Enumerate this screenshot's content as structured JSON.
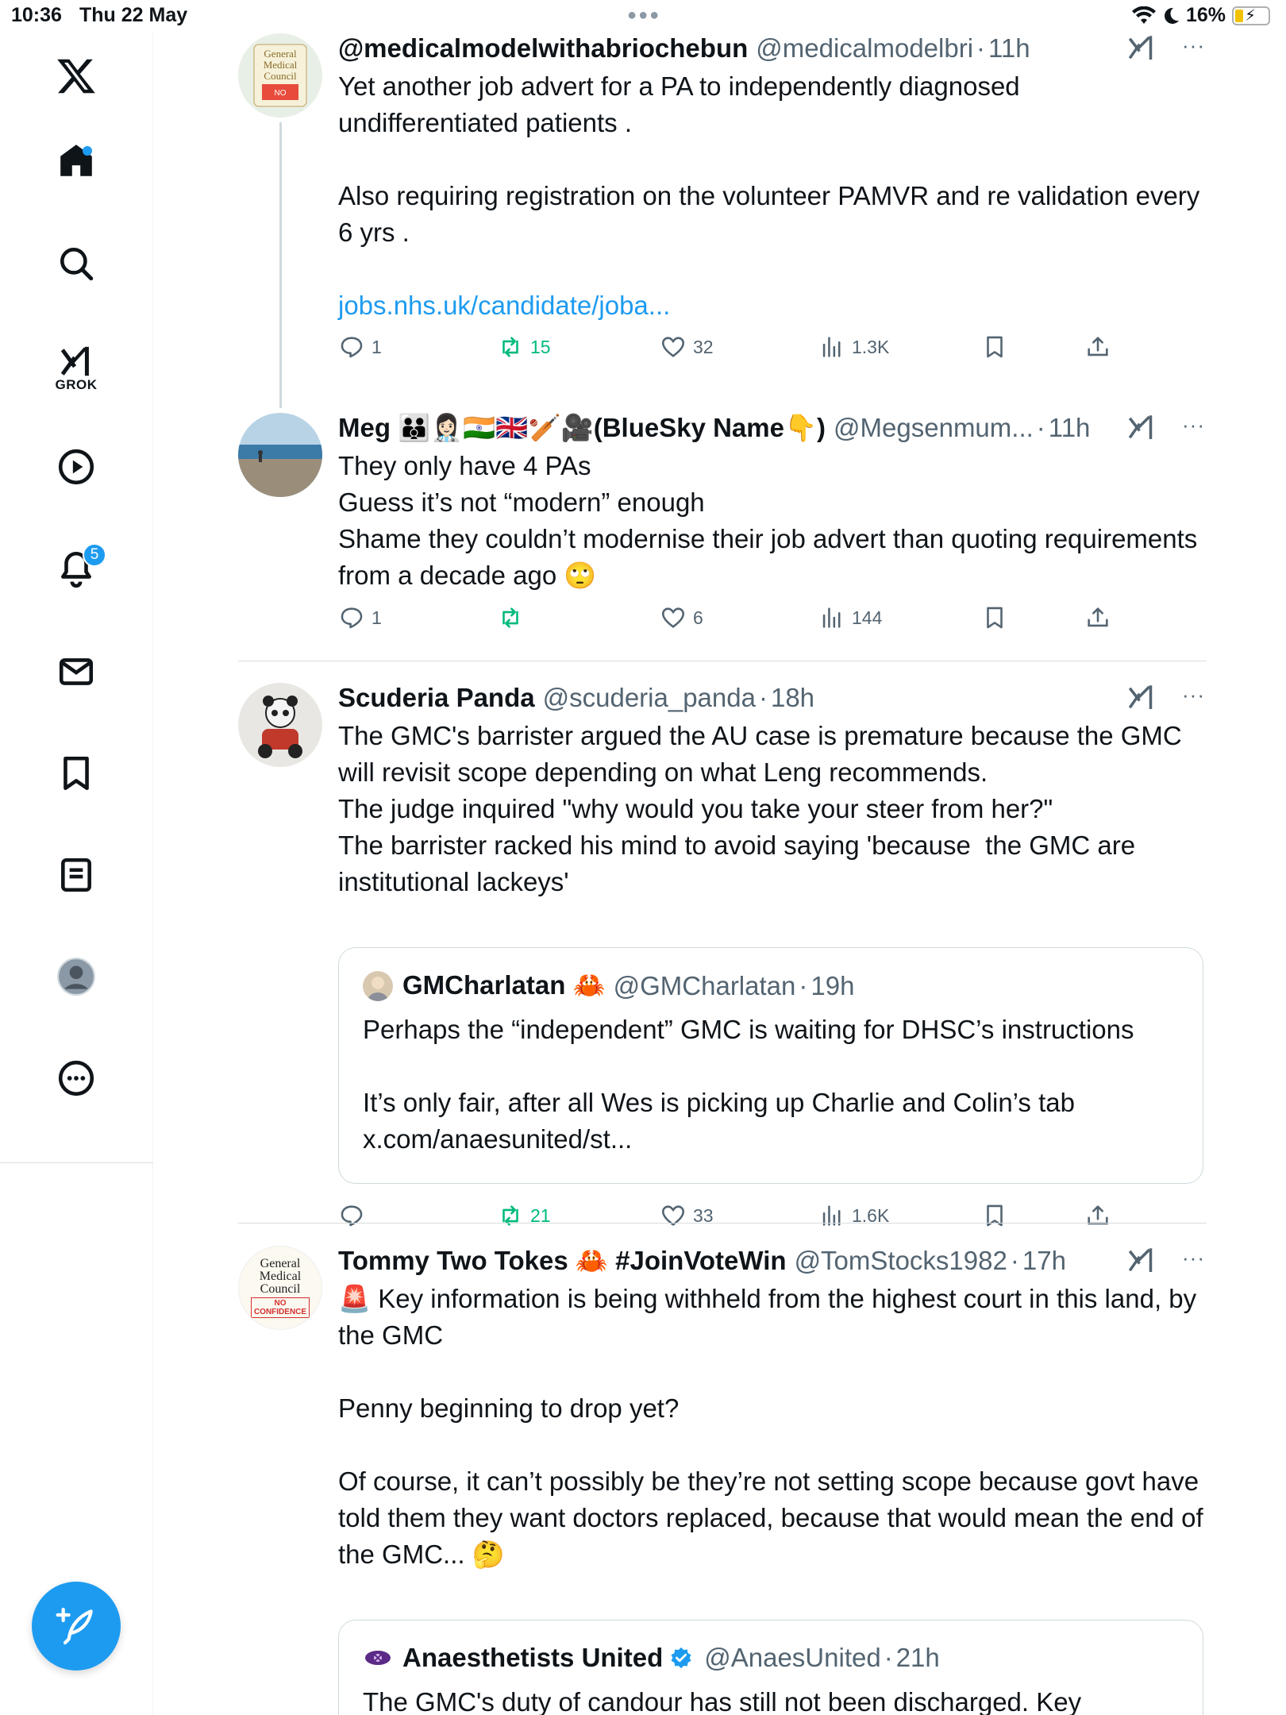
{
  "status_bar": {
    "time": "10:36",
    "date": "Thu 22 May",
    "battery": "16%",
    "battery_level": 0.16
  },
  "sidebar": {
    "logo": "X",
    "grok_label": "GROK",
    "notification_count": "5",
    "items": [
      {
        "name": "home",
        "icon": "home-icon"
      },
      {
        "name": "explore",
        "icon": "search-icon"
      },
      {
        "name": "grok",
        "icon": "grok-icon"
      },
      {
        "name": "video",
        "icon": "play-icon"
      },
      {
        "name": "notifications",
        "icon": "bell-icon"
      },
      {
        "name": "messages",
        "icon": "mail-icon"
      },
      {
        "name": "bookmarks",
        "icon": "bookmark-icon"
      },
      {
        "name": "lists",
        "icon": "list-icon"
      },
      {
        "name": "profile",
        "icon": "avatar-icon"
      },
      {
        "name": "more",
        "icon": "more-icon"
      }
    ],
    "compose_icon": "compose-icon"
  },
  "colors": {
    "accent": "#1d9bf0",
    "retweet_green": "#00ba7c",
    "secondary_text": "#536471"
  },
  "tweets": [
    {
      "name": "@medicalmodelwithabriochebun",
      "handle": "@medicalmodelbri",
      "time": "11h",
      "text": "Yet another job advert for a PA to independently diagnosed undifferentiated patients .\n\nAlso requiring registration on the volunteer PAMVR and re validation every 6 yrs .\n\n",
      "link": "jobs.nhs.uk/candidate/joba...",
      "replies": "1",
      "retweets": "15",
      "likes": "32",
      "views": "1.3K",
      "avatar_label": "General Medical Council"
    },
    {
      "name": "Meg 👪👩🏻‍⚕️🇮🇳🇬🇧🏏🎥(BlueSky Name👇)",
      "handle": "@Megsenmum...",
      "time": "11h",
      "text": "They only have 4 PAs\nGuess it’s not “modern” enough\nShame they couldn’t modernise their job advert than quoting requirements from a decade ago 🙄",
      "replies": "1",
      "retweets": "",
      "likes": "6",
      "views": "144"
    },
    {
      "name": "Scuderia Panda",
      "handle": "@scuderia_panda",
      "time": "18h",
      "text": "The GMC's barrister argued the AU case is premature because the GMC will revisit scope depending on what Leng recommends.\nThe judge inquired \"why would you take your steer from her?\"\nThe barrister racked his mind to avoid saying 'because  the GMC are institutional lackeys'",
      "replies": "",
      "retweets": "21",
      "likes": "33",
      "views": "1.6K",
      "quote": {
        "name": "GMCharlatan 🦀",
        "handle": "@GMCharlatan",
        "time": "19h",
        "text": "Perhaps the “independent” GMC is waiting for DHSC’s instructions\n\nIt’s only fair, after all Wes is picking up Charlie and Colin’s tab\nx.com/anaesunited/st..."
      }
    },
    {
      "name": "Tommy Two Tokes 🦀 #JoinVoteWin",
      "handle": "@TomStocks1982",
      "time": "17h",
      "text": "🚨 Key information is being withheld from the highest court in this land, by the GMC\n\nPenny beginning to drop yet?\n\nOf course, it can’t possibly be they’re not setting scope because govt have told them they want doctors replaced, because that would mean the end of the GMC... 🤔",
      "avatar_lines": [
        "General",
        "Medical",
        "Council",
        "NO",
        "CONFIDENCE"
      ],
      "quote": {
        "name": "Anaesthetists United",
        "handle": "@AnaesUnited",
        "time": "21h",
        "text": "The GMC's duty of candour has still not been discharged. Key information has not yet been delivered to the Court"
      }
    }
  ]
}
